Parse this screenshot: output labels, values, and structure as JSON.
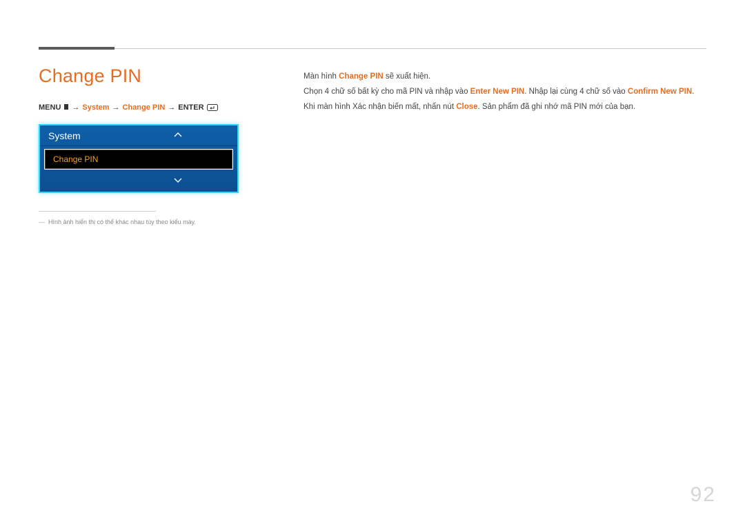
{
  "heading": "Change PIN",
  "breadcrumb": {
    "menu": "MENU",
    "arrow": "→",
    "system": "System",
    "changePin": "Change PIN",
    "enter": "ENTER"
  },
  "osd": {
    "title": "System",
    "item": "Change PIN"
  },
  "footnote": "Hình ảnh hiển thị có thể khác nhau tùy theo kiểu máy.",
  "body": {
    "line1_pre": "Màn hình ",
    "line1_hl": "Change PIN",
    "line1_post": " sẽ xuất hiện.",
    "line2_pre": "Chọn 4 chữ số bất kỳ cho mã PIN và nhập vào ",
    "line2_hl1": "Enter New PIN",
    "line2_mid": ". Nhập lại cùng 4 chữ số vào ",
    "line2_hl2": "Confirm New PIN",
    "line2_post": ".",
    "line3_pre": "Khi màn hình Xác nhận biến mất, nhấn nút ",
    "line3_hl": "Close",
    "line3_post": ". Sản phẩm đã ghi nhớ mã PIN mới của bạn."
  },
  "pageNumber": "92"
}
